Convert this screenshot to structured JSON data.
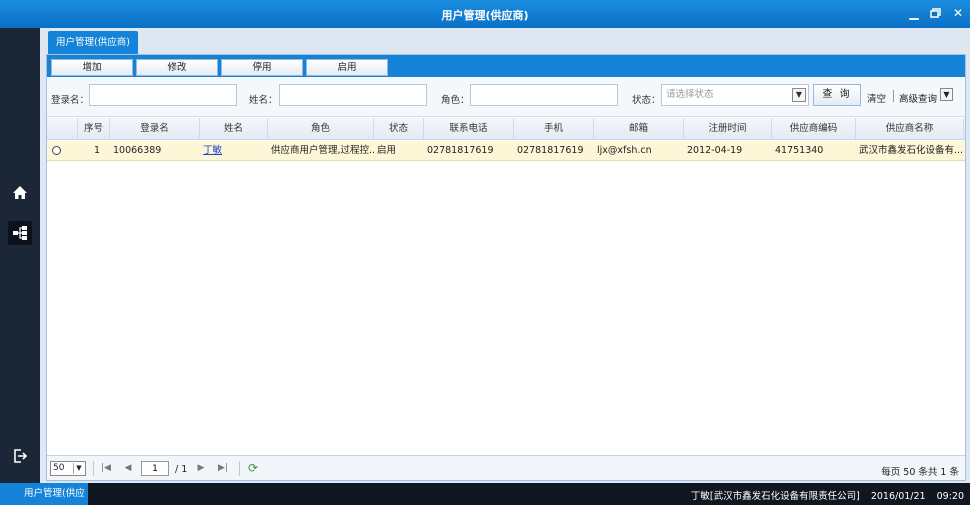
{
  "window": {
    "title": "用户管理(供应商)"
  },
  "tab": {
    "label": "用户管理(供应商)"
  },
  "toolbar": {
    "add": "增加",
    "edit": "修改",
    "disable": "停用",
    "enable": "启用"
  },
  "search": {
    "login_label": "登录名：",
    "name_label": "姓名：",
    "role_label": "角色：",
    "status_label": "状态：",
    "status_placeholder": "请选择状态",
    "query_button": "查 询",
    "clear": "清空",
    "advanced": "高级查询"
  },
  "grid": {
    "columns": [
      "序号",
      "登录名",
      "姓名",
      "角色",
      "状态",
      "联系电话",
      "手机",
      "邮箱",
      "注册时间",
      "供应商编码",
      "供应商名称"
    ],
    "rows": [
      {
        "index": "1",
        "login": "10066389",
        "name": "丁敏",
        "role": "供应商用户管理,过程控...",
        "status": "启用",
        "phone": "02781817619",
        "mobile": "02781817619",
        "email": "ljx@xfsh.cn",
        "reg_date": "2012-04-19",
        "supplier_code": "41751340",
        "supplier_name": "武汉市鑫发石化设备有..."
      }
    ]
  },
  "pager": {
    "page_size": "50",
    "current_page": "1",
    "total_pages": "/ 1",
    "info": "每页 50 条共 1 条"
  },
  "taskbar": {
    "active_item": "用户管理(供应",
    "user": "丁敏[武汉市鑫发石化设备有限责任公司]",
    "date": "2016/01/21",
    "time": "09:20"
  }
}
